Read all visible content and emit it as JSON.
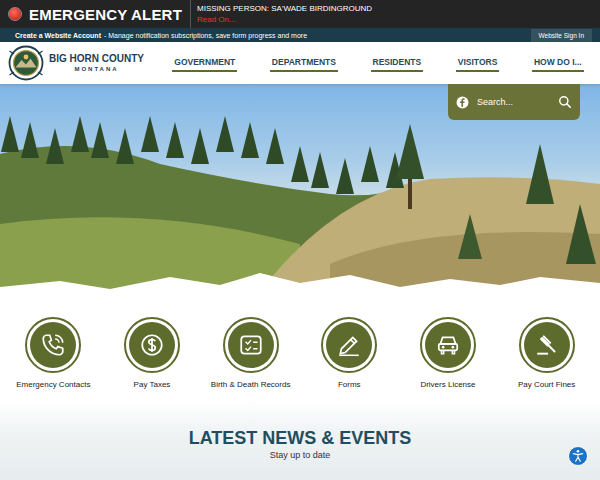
{
  "alert": {
    "label": "EMERGENCY ALERT",
    "title": "MISSING PERSON: SA'WADE BIRDINGROUND",
    "link": "Read On..."
  },
  "account_bar": {
    "link": "Create a Website Account",
    "text": "- Manage notification subscriptions, save form progress and more",
    "sign_in": "Website Sign In"
  },
  "logo": {
    "name": "BIG HORN COUNTY",
    "state": "MONTANA"
  },
  "nav": [
    "GOVERNMENT",
    "DEPARTMENTS",
    "RESIDENTS",
    "VISITORS",
    "HOW DO I..."
  ],
  "search": {
    "placeholder": "Search..."
  },
  "quick_links": [
    "Emergency Contacts",
    "Pay Taxes",
    "Birth & Death Records",
    "Forms",
    "Drivers License",
    "Pay Court Fines"
  ],
  "news": {
    "title": "LATEST NEWS & EVENTS",
    "subtitle": "Stay up to date"
  }
}
